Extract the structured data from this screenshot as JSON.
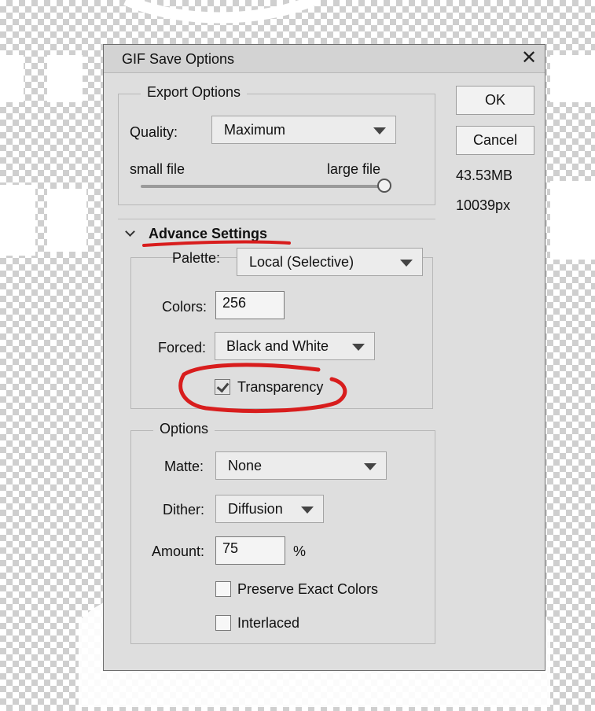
{
  "dialog": {
    "title": "GIF Save Options",
    "close_icon": "close-icon"
  },
  "buttons": {
    "ok": "OK",
    "cancel": "Cancel"
  },
  "info": {
    "size": "43.53MB",
    "dimension": "10039px"
  },
  "export_options": {
    "legend": "Export Options",
    "quality_label": "Quality:",
    "quality_value": "Maximum",
    "slider_min_label": "small file",
    "slider_max_label": "large file",
    "slider_value": 1.0
  },
  "advance_settings": {
    "title": "Advance Settings",
    "palette_label": "Palette:",
    "palette_value": "Local (Selective)",
    "colors_label": "Colors:",
    "colors_value": "256",
    "forced_label": "Forced:",
    "forced_value": "Black and White",
    "transparency_label": "Transparency",
    "transparency_checked": true
  },
  "options": {
    "legend": "Options",
    "matte_label": "Matte:",
    "matte_value": "None",
    "dither_label": "Dither:",
    "dither_value": "Diffusion",
    "amount_label": "Amount:",
    "amount_value": "75",
    "amount_unit": "%",
    "preserve_label": "Preserve Exact Colors",
    "preserve_checked": false,
    "interlaced_label": "Interlaced",
    "interlaced_checked": false
  },
  "colors": {
    "annotation": "#d81d1d",
    "dialog_bg": "#dedede"
  }
}
